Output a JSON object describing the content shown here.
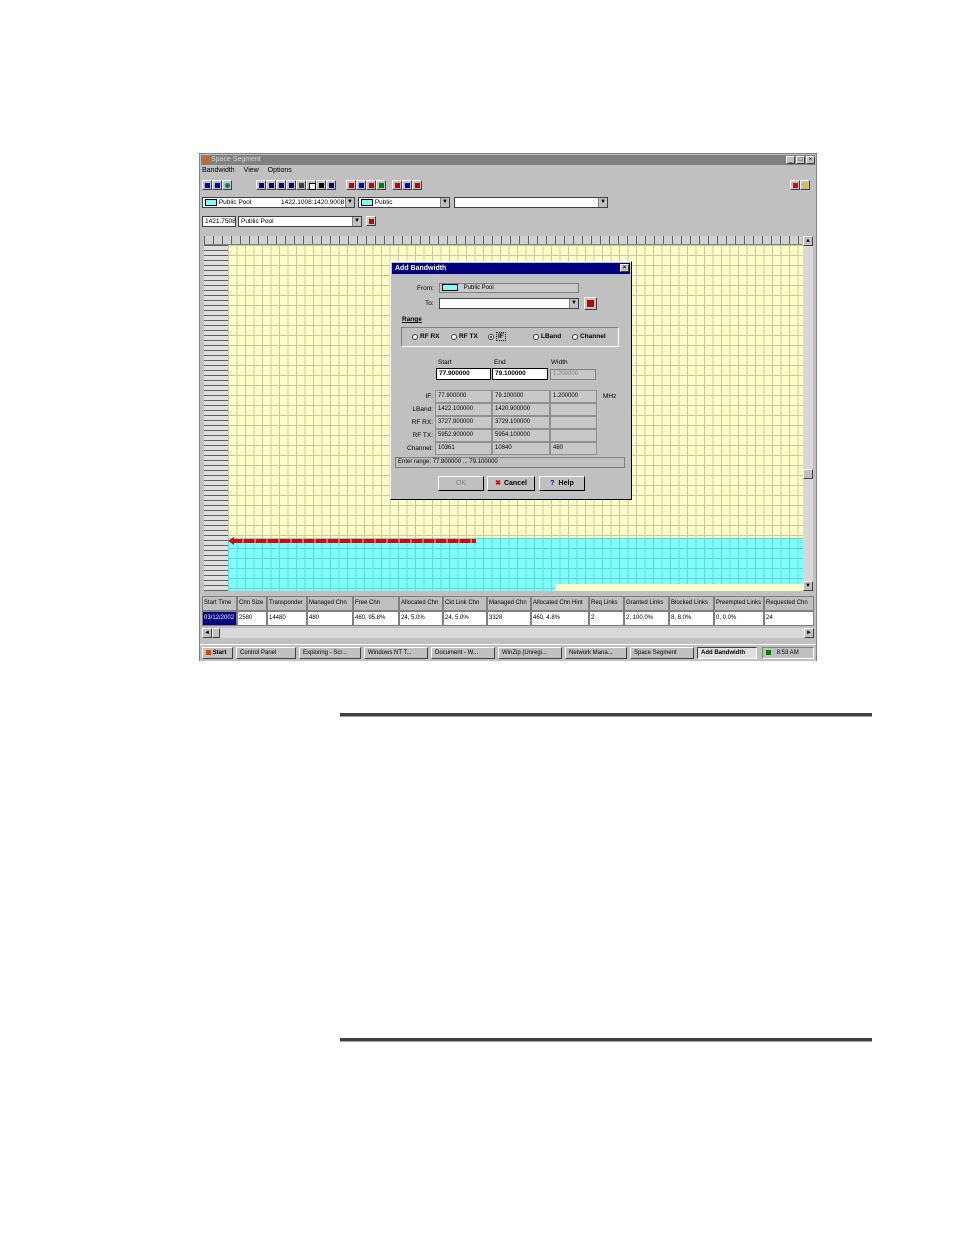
{
  "window": {
    "title": "Space Segment",
    "menu": [
      "Bandwidth",
      "View",
      "Options"
    ]
  },
  "toolbar": {
    "pool_combo": "Public Pool",
    "freq_range": "1422.1008:1420.9008",
    "access_combo": "Public",
    "blank_combo": "",
    "freq_value": "1421.7508",
    "pool_combo2": "Public Pool"
  },
  "grid": {
    "table_headers": [
      "Start Time",
      "Chn Size",
      "Transponder",
      "Managed Chn",
      "Free Chn",
      "Allocated Chn",
      "Ckt Link Chn",
      "Managed Chn",
      "Allocated Chn Hint",
      "Req Links",
      "Granted Links",
      "Blocked Links",
      "Preempted Links",
      "Requested Chn"
    ],
    "table_row": [
      "03/12/2002",
      "2580",
      "14480",
      "480",
      "460, 95.8%",
      "24, 5.0%",
      "24, 5.0%",
      "3328",
      "460, 4.8%",
      "2",
      "2, 100.0%",
      "8, 8.0%",
      "0, 0.0%",
      "24"
    ]
  },
  "taskbar": {
    "start": "Start",
    "items": [
      "Control Panel",
      "Exploring - Scr...",
      "Windows NT T...",
      "Document - W...",
      "WinZip (Unregi...",
      "Network Mana...",
      "Space Segment",
      "Add Bandwidth"
    ],
    "clock": "8:53 AM"
  },
  "dialog": {
    "title": "Add Bandwidth",
    "from_label": "From:",
    "from_value": "Public Pool",
    "to_label": "To:",
    "to_value": "",
    "range_group": "Range",
    "radio_options": [
      "RF RX",
      "RF TX",
      "IF",
      "LBand",
      "Channel"
    ],
    "selected_radio": "IF",
    "col_start": "Start",
    "col_end": "End",
    "col_width": "Width",
    "start_value": "77.900000",
    "end_value": "79.100000",
    "width_value": "1.200000",
    "mhz": "MHz",
    "rows": [
      {
        "label": "IF:",
        "start": "77.900000",
        "end": "79.100000",
        "width": "1.200000"
      },
      {
        "label": "LBand:",
        "start": "1422.100000",
        "end": "1420.900000",
        "width": ""
      },
      {
        "label": "RF RX:",
        "start": "3727.900000",
        "end": "3729.100000",
        "width": ""
      },
      {
        "label": "RF TX:",
        "start": "5952.900000",
        "end": "5954.100000",
        "width": ""
      },
      {
        "label": "Channel:",
        "start": "10361",
        "end": "10840",
        "width": "480"
      }
    ],
    "status": "Enter range: 77.900000 ... 79.100000",
    "ok": "OK",
    "cancel": "Cancel",
    "help": "Help"
  }
}
